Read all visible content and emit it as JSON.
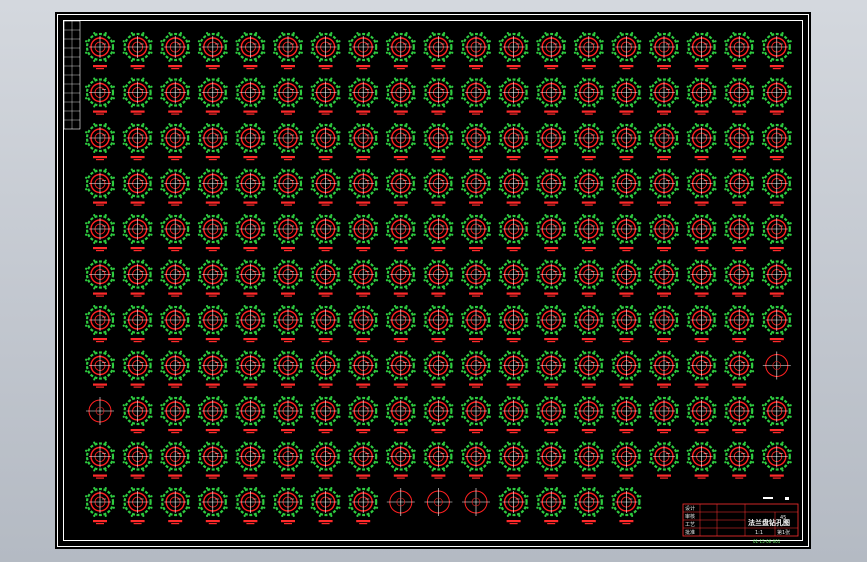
{
  "drawing": {
    "background": "#000000",
    "app_background": "#c6cbd3",
    "colors": {
      "frame": "#ffffff",
      "outer_ring": "#2ecc40",
      "hole_circle": "#ff2020",
      "crosshair": "#ffffff",
      "label": "#ff2a2a",
      "title_frame": "#ff3030"
    },
    "grid": {
      "rows": 11,
      "cols": 19,
      "last_row_count": 15,
      "simple_markers": [
        [
          7,
          18
        ],
        [
          8,
          0
        ],
        [
          10,
          8
        ],
        [
          10,
          9
        ],
        [
          10,
          10
        ]
      ]
    },
    "title_block": {
      "drawing_name": "法兰盘钻孔图",
      "material": "45",
      "scale": "1:1",
      "sheet": "第1张",
      "labels": [
        "设计",
        "审核",
        "工艺",
        "批准"
      ],
      "footer": "01-15-06-001"
    },
    "revision_table": {
      "rows": 12
    }
  }
}
